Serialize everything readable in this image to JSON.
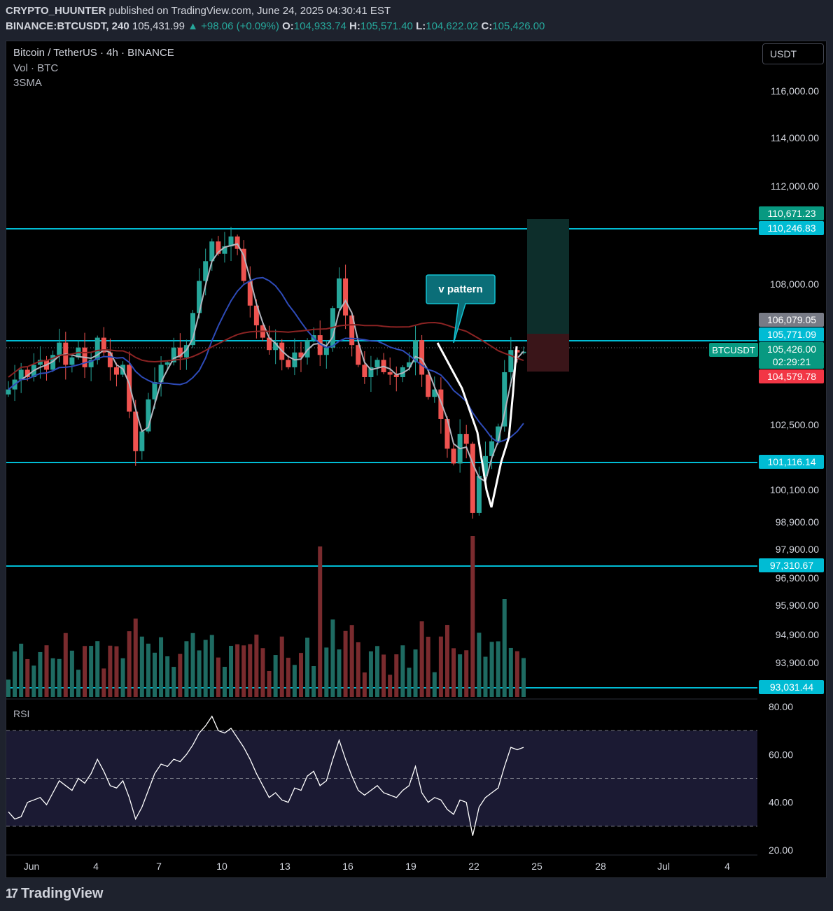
{
  "header": {
    "author": "CRYPTO_HUUNTER",
    "published": "published on TradingView.com, June 24, 2025 04:30:41 EST",
    "symbol": "BINANCE:BTCUSDT, 240",
    "last": "105,431.99",
    "change": "▲ +98.06 (+0.09%)",
    "o_label": "O:",
    "o": "104,933.74",
    "h_label": "H:",
    "h": "105,571.40",
    "l_label": "L:",
    "l": "104,622.02",
    "c_label": "C:",
    "c": "105,426.00"
  },
  "legend": {
    "title": "Bitcoin / TetherUS · 4h · BINANCE",
    "vol": "Vol · BTC",
    "sma": "3SMA"
  },
  "currency": "USDT",
  "annotation": {
    "text": "v pattern"
  },
  "symbol_tag": "BTCUSDT",
  "rsi_label": "RSI",
  "brand": {
    "logo": "17",
    "name": "TradingView"
  },
  "colors": {
    "up": "#26a69a",
    "down": "#ef5350",
    "hline": "#00bcd4",
    "sma_blue": "#2e4bb8",
    "sma_red": "#8b2323",
    "sma_gray": "#b2b5be",
    "rsi_band": "#1b1a33"
  },
  "chart_data": [
    {
      "type": "candlestick",
      "title": "Bitcoin / TetherUS · 4h · BINANCE",
      "y_ticks": [
        "116,000.00",
        "114,000.00",
        "112,000.00",
        "108,000.00",
        "102,500.00",
        "100,100.00",
        "98,900.00",
        "97,900.00",
        "96,900.00",
        "95,900.00",
        "94,900.00",
        "93,900.00"
      ],
      "x_ticks": [
        "Jun",
        "4",
        "7",
        "10",
        "13",
        "16",
        "19",
        "22",
        "25",
        "28",
        "Jul",
        "4"
      ],
      "horizontal_levels": [
        "110,246.83",
        "105,771.09",
        "101,116.14",
        "97,310.67",
        "93,031.44"
      ],
      "price_tags": [
        {
          "label": "110,671.23",
          "color": "#089981"
        },
        {
          "label": "110,246.83",
          "color": "#00bcd4"
        },
        {
          "label": "106,079.05",
          "color": "#787b86"
        },
        {
          "label": "105,771.09",
          "color": "#00bcd4"
        },
        {
          "label": "105,426.00",
          "color": "#089981"
        },
        {
          "label": "02:29:21",
          "color": "#089981"
        },
        {
          "label": "104,579.78",
          "color": "#f23645"
        },
        {
          "label": "101,116.14",
          "color": "#00bcd4"
        },
        {
          "label": "97,310.67",
          "color": "#00bcd4"
        },
        {
          "label": "93,031.44",
          "color": "#00bcd4"
        }
      ],
      "long_position": {
        "target": "110,671.23",
        "entry": "106,079.05",
        "stop": "104,579.78"
      },
      "close_series": [
        103900,
        104300,
        104700,
        104400,
        104900,
        105100,
        104700,
        105300,
        105800,
        104900,
        105200,
        105600,
        104800,
        105100,
        106000,
        105400,
        104800,
        104500,
        104900,
        103000,
        101400,
        102200,
        103500,
        104200,
        104900,
        105000,
        105600,
        105200,
        105700,
        107000,
        108300,
        109100,
        109900,
        109400,
        109700,
        110100,
        109600,
        108300,
        107300,
        106500,
        106000,
        105500,
        105800,
        105100,
        104800,
        105400,
        105200,
        105900,
        106100,
        105300,
        105600,
        107200,
        108400,
        106900,
        105700,
        104900,
        104400,
        104800,
        105100,
        104600,
        104500,
        104400,
        104800,
        105000,
        105900,
        104500,
        103600,
        103900,
        102700,
        101500,
        100900,
        102100,
        101700,
        98900,
        100400,
        101200,
        101800,
        102400,
        104600,
        105500,
        105400,
        105430
      ]
    },
    {
      "type": "bar",
      "title": "Vol · BTC"
    },
    {
      "type": "line",
      "title": "RSI",
      "y_ticks": [
        "80.00",
        "60.00",
        "40.00",
        "20.00"
      ],
      "ylim": [
        20,
        80
      ],
      "bands": [
        30,
        50,
        70
      ],
      "values": [
        36,
        33,
        34,
        40,
        41,
        42,
        39,
        44,
        49,
        47,
        45,
        50,
        48,
        52,
        58,
        53,
        47,
        46,
        49,
        42,
        33,
        38,
        45,
        52,
        56,
        55,
        58,
        57,
        60,
        64,
        69,
        72,
        76,
        70,
        69,
        71,
        67,
        63,
        58,
        52,
        47,
        42,
        44,
        41,
        40,
        46,
        45,
        51,
        53,
        47,
        49,
        58,
        66,
        58,
        51,
        45,
        43,
        45,
        47,
        44,
        43,
        42,
        45,
        47,
        55,
        44,
        40,
        42,
        41,
        37,
        35,
        41,
        40,
        26,
        38,
        42,
        44,
        46,
        55,
        63,
        62,
        63
      ]
    }
  ]
}
